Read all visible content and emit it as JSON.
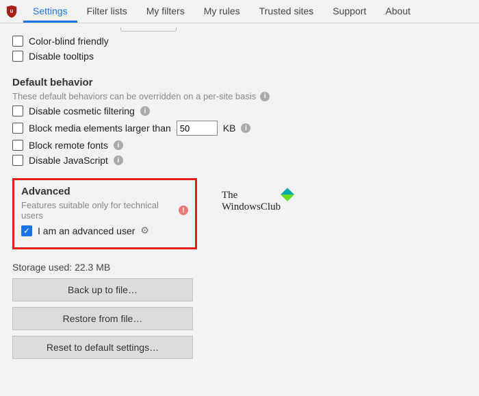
{
  "tabs": [
    "Settings",
    "Filter lists",
    "My filters",
    "My rules",
    "Trusted sites",
    "Support",
    "About"
  ],
  "activeTab": 0,
  "topOptions": [
    {
      "label": "Color-blind friendly",
      "checked": false
    },
    {
      "label": "Disable tooltips",
      "checked": false
    }
  ],
  "behavior": {
    "title": "Default behavior",
    "subtitle": "These default behaviors can be overridden on a per-site basis",
    "options": [
      {
        "label": "Disable cosmetic filtering",
        "checked": false,
        "info": true
      },
      {
        "label": "Block media elements larger than",
        "checked": false,
        "value": "50",
        "unit": "KB",
        "info": true
      },
      {
        "label": "Block remote fonts",
        "checked": false,
        "info": true
      },
      {
        "label": "Disable JavaScript",
        "checked": false,
        "info": true
      }
    ]
  },
  "advanced": {
    "title": "Advanced",
    "subtitle": "Features suitable only for technical users",
    "option": {
      "label": "I am an advanced user",
      "checked": true
    }
  },
  "storage": {
    "label": "Storage used:",
    "value": "22.3 MB"
  },
  "buttons": [
    "Back up to file…",
    "Restore from file…",
    "Reset to default settings…"
  ],
  "watermark": {
    "line1": "The",
    "line2": "WindowsClub"
  }
}
